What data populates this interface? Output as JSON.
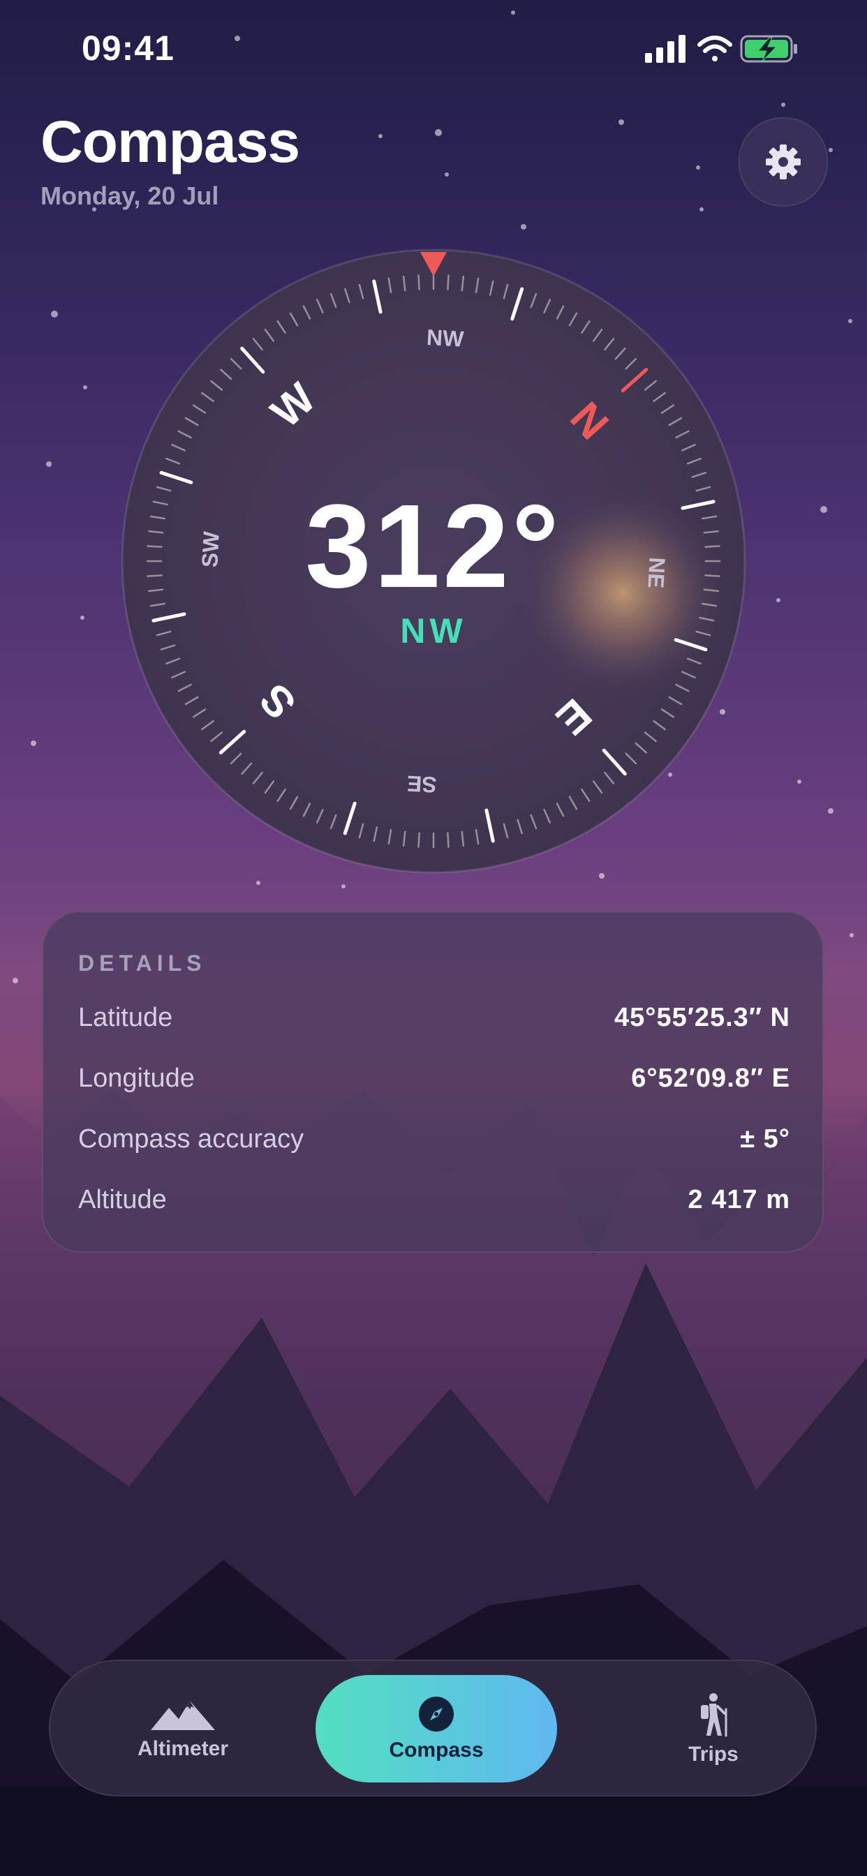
{
  "status_bar": {
    "time": "09:41",
    "icons": [
      "signal-icon",
      "wifi-icon",
      "battery-charging-icon"
    ]
  },
  "header": {
    "title": "Compass",
    "date": "Monday, 20 Jul",
    "settings_icon": "gear-icon"
  },
  "compass": {
    "heading_degrees": "312°",
    "heading_cardinal": "NW",
    "heading_value": 312,
    "dial_labels": {
      "N": "N",
      "E": "E",
      "S": "S",
      "W": "W",
      "NE": "NE",
      "SE": "SE",
      "SW": "SW",
      "NW": "NW"
    },
    "colors": {
      "north": "#ee5a57",
      "heading_accent": "#45e0b8",
      "pointer": "#ee5a57"
    }
  },
  "details": {
    "heading": "DETAILS",
    "rows": [
      {
        "label": "Latitude",
        "value": "45°55′25.3″ N"
      },
      {
        "label": "Longitude",
        "value": "6°52′09.8″ E"
      },
      {
        "label": "Compass accuracy",
        "value": "± 5°"
      },
      {
        "label": "Altitude",
        "value": "2 417 m"
      }
    ]
  },
  "tabbar": {
    "tabs": [
      {
        "label": "Altimeter",
        "icon": "mountains-icon",
        "active": false
      },
      {
        "label": "Compass",
        "icon": "compass-icon",
        "active": true
      },
      {
        "label": "Trips",
        "icon": "hiker-icon",
        "active": false
      }
    ],
    "active_gradient": [
      "#52dfc1",
      "#5fb8f0"
    ]
  }
}
